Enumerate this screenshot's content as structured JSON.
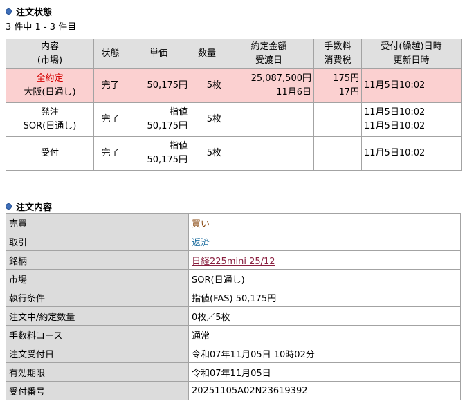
{
  "order_status": {
    "title": "注文状態",
    "count": "3 件中 1 - 3 件目",
    "headers": {
      "naiyo": "内容",
      "shijo": "(市場)",
      "jotai": "状態",
      "tanka": "単価",
      "suryo": "数量",
      "yakujo_kingaku": "約定金額",
      "ukewatashibi": "受渡日",
      "tesuryo": "手数料",
      "shohizei": "消費税",
      "uketsuke": "受付(繰越)日時",
      "koshin": "更新日時"
    },
    "rows": [
      {
        "naiyo1": "全約定",
        "naiyo2": "大阪(日通し)",
        "jotai": "完了",
        "tanka_type": "",
        "tanka": "50,175円",
        "suryo": "5枚",
        "kingaku": "25,087,500円",
        "ukewatashi": "11月6日",
        "tesuryo": "175円",
        "shohizei": "17円",
        "uketsuke": "",
        "koshin": "11月5日10:02"
      },
      {
        "naiyo1": "発注",
        "naiyo2": "SOR(日通し)",
        "jotai": "完了",
        "tanka_type": "指値",
        "tanka": "50,175円",
        "suryo": "5枚",
        "kingaku": "",
        "ukewatashi": "",
        "tesuryo": "",
        "shohizei": "",
        "uketsuke": "11月5日10:02",
        "koshin": "11月5日10:02"
      },
      {
        "naiyo1": "受付",
        "naiyo2": "",
        "jotai": "完了",
        "tanka_type": "指値",
        "tanka": "50,175円",
        "suryo": "5枚",
        "kingaku": "",
        "ukewatashi": "",
        "tesuryo": "",
        "shohizei": "",
        "uketsuke": "",
        "koshin": "11月5日10:02"
      }
    ]
  },
  "order_detail": {
    "title": "注文内容",
    "rows": [
      {
        "label": "売買",
        "value": "買い"
      },
      {
        "label": "取引",
        "value": "返済"
      },
      {
        "label": "銘柄",
        "value": "日経225mini 25/12"
      },
      {
        "label": "市場",
        "value": "SOR(日通し)"
      },
      {
        "label": "執行条件",
        "value": "指値(FAS) 50,175円"
      },
      {
        "label": "注文中/約定数量",
        "value": "0枚／5枚"
      },
      {
        "label": "手数料コース",
        "value": "通常"
      },
      {
        "label": "注文受付日",
        "value": "令和07年11月05日 10時02分"
      },
      {
        "label": "有効期限",
        "value": "令和07年11月05日"
      },
      {
        "label": "受付番号",
        "value": "20251105A02N23619392"
      }
    ]
  },
  "colors": {
    "highlight_row": "#fbd0d0",
    "header_bg": "#e0e0e0",
    "status_red": "#d50000",
    "buy_brown": "#8a4a12",
    "torihiki_teal": "#1f6fa0",
    "link_color": "#8a2040",
    "bullet_blue": "#3f6fb8"
  }
}
